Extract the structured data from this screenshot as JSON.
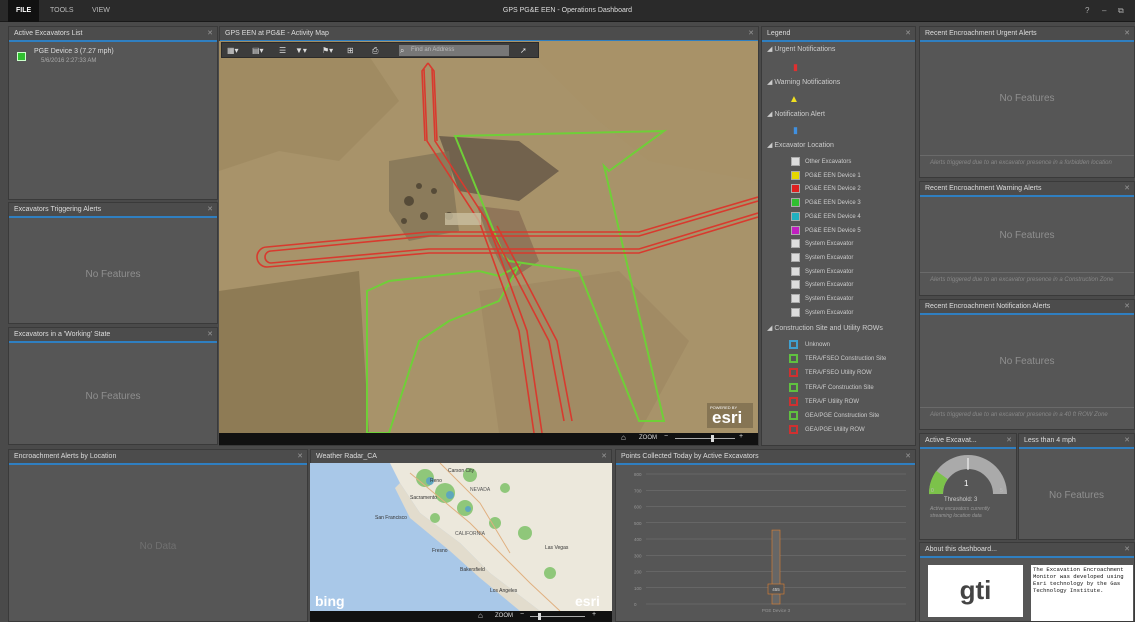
{
  "menu": {
    "file": "FILE",
    "tools": "TOOLS",
    "view": "VIEW"
  },
  "app_title": "GPS PG&E EEN - Operations Dashboard",
  "window_controls": {
    "help": "?",
    "minimize": "–",
    "restore": "⧉"
  },
  "panels": {
    "active_list": {
      "title": "Active Excavators List",
      "item_name": "PGE Device 3 (7.27 mph)",
      "item_time": "5/6/2016 2:27:33 AM"
    },
    "triggering": {
      "title": "Excavators Triggering Alerts",
      "empty": "No Features"
    },
    "working": {
      "title": "Excavators in a 'Working' State",
      "empty": "No Features"
    },
    "encroach_loc": {
      "title": "Encroachment Alerts by Location",
      "empty": "No Data"
    },
    "map": {
      "title": "GPS EEN at PG&E - Activity Map",
      "search_placeholder": "Find an Address",
      "zoom": "ZOOM",
      "powered": "POWERED BY",
      "brand": "esri"
    },
    "legend": {
      "title": "Legend"
    },
    "urgent": {
      "title": "Recent Encroachment Urgent Alerts",
      "empty": "No Features",
      "desc": "Alerts triggered due to an excavator presence in a forbidden location"
    },
    "warning": {
      "title": "Recent Encroachment Warning Alerts",
      "empty": "No Features",
      "desc": "Alerts triggered due to an excavator presence in a Construction Zone"
    },
    "notification": {
      "title": "Recent Encroachment Notification Alerts",
      "empty": "No Features",
      "desc": "Alerts triggered due to an excavator presence in a 40 ft ROW Zone"
    },
    "radar": {
      "title": "Weather Radar_CA",
      "zoom": "ZOOM",
      "bing": "bing",
      "esri": "esri"
    },
    "points": {
      "title": "Points Collected Today by Active Excavators",
      "bar_value": "455",
      "category": "PGE Device 3"
    },
    "gauge": {
      "title": "Active Excavat...",
      "value": "1",
      "threshold": "Threshold: 3",
      "desc": "Active excavators currently streaming location data",
      "min": "0",
      "max": "5"
    },
    "speed": {
      "title": "Less than 4 mph",
      "empty": "No Features"
    },
    "about": {
      "title": "About this dashboard...",
      "logo": "gti",
      "text": "The Excavation Encroachment Monitor was developed using Esri technology by the Gas Technology Institute."
    }
  },
  "legend": {
    "groups": [
      "Urgent Notifications",
      "Warning Notifications",
      "Notification Alert",
      "Excavator Location",
      "Construction Site and Utility ROWs"
    ],
    "excavators": [
      {
        "label": "Other Excavators",
        "color": "#dddddd"
      },
      {
        "label": "PG&E EEN Device 1",
        "color": "#e6d800"
      },
      {
        "label": "PG&E EEN Device 2",
        "color": "#e02020"
      },
      {
        "label": "PG&E EEN Device 3",
        "color": "#30c030"
      },
      {
        "label": "PG&E EEN Device 4",
        "color": "#20b0c0"
      },
      {
        "label": "PG&E EEN Device 5",
        "color": "#c020c0"
      },
      {
        "label": "System Excavator",
        "color": "#dddddd"
      },
      {
        "label": "System Excavator",
        "color": "#dddddd"
      },
      {
        "label": "System Excavator",
        "color": "#dddddd"
      },
      {
        "label": "System Excavator",
        "color": "#dddddd"
      },
      {
        "label": "System Excavator",
        "color": "#dddddd"
      },
      {
        "label": "System Excavator",
        "color": "#dddddd"
      }
    ],
    "sites": [
      {
        "label": "Unknown",
        "color": "#40a0d0"
      },
      {
        "label": "TERA/FSEO Construction Site",
        "color": "#60c040"
      },
      {
        "label": "TERA/FSEO Utility ROW",
        "color": "#d03030"
      },
      {
        "label": "TERA/F Construction Site",
        "color": "#60c040"
      },
      {
        "label": "TERA/F Utility ROW",
        "color": "#d03030"
      },
      {
        "label": "GEA/PGE Construction Site",
        "color": "#60c040"
      },
      {
        "label": "GEA/PGE Utility ROW",
        "color": "#d03030"
      }
    ]
  },
  "chart_data": {
    "type": "bar",
    "title": "Points Collected Today by Active Excavators",
    "categories": [
      "PGE Device 3"
    ],
    "values": [
      455
    ],
    "ylim": [
      0,
      800
    ],
    "yticks": [
      "0",
      "100",
      "200",
      "300",
      "400",
      "500",
      "600",
      "700",
      "800"
    ]
  },
  "radar_labels": [
    "NEVADA",
    "CALIFORNIA",
    "San Francisco",
    "Fresno",
    "Bakersfield",
    "Los Angeles",
    "Las Vegas",
    "Sacramento",
    "Reno",
    "Carson City"
  ],
  "colors": {
    "accent": "#2f7fc1",
    "row_red": "#d03030",
    "site_green": "#60c040"
  }
}
